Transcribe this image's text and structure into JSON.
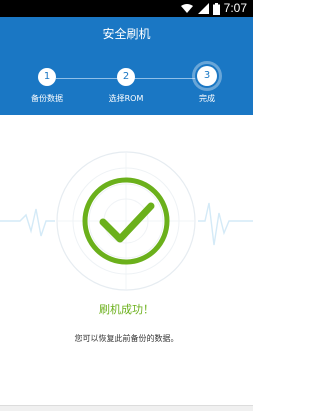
{
  "status_bar": {
    "time": "7:07"
  },
  "header": {
    "title": "安全刷机"
  },
  "steps": [
    {
      "number": "1",
      "label": "备份数据"
    },
    {
      "number": "2",
      "label": "选择ROM"
    },
    {
      "number": "3",
      "label": "完成"
    }
  ],
  "result": {
    "title": "刷机成功！",
    "description": "您可以恢复此前备份的数据。"
  },
  "colors": {
    "header": "#1a77c4",
    "success": "#6bb01b"
  }
}
